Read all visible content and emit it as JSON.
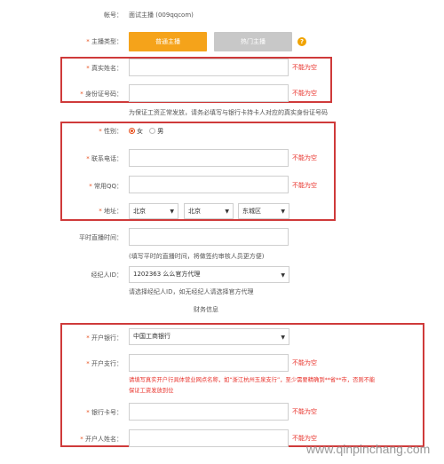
{
  "account": {
    "label": "帐号：",
    "value": "面试主播 (009qqcom)"
  },
  "anchor_type": {
    "label": "主播类型：",
    "normal_button": "普通主播",
    "hot_button": "热门主播",
    "help_glyph": "?"
  },
  "real_name": {
    "label": "真实姓名：",
    "error": "不能为空"
  },
  "id_number": {
    "label": "身份证号码：",
    "error": "不能为空"
  },
  "id_hint": "为保证工资正常发放，请务必填写与银行卡持卡人对应的真实身份证号码",
  "gender": {
    "label": "性别：",
    "female": "女",
    "male": "男"
  },
  "phone": {
    "label": "联系电话：",
    "error": "不能为空"
  },
  "qq": {
    "label": "常用QQ：",
    "error": "不能为空"
  },
  "address": {
    "label": "地址：",
    "province": "北京",
    "city": "北京",
    "district": "东城区"
  },
  "live_time": {
    "label": "平时直播时间：",
    "hint": "(填写平时的直播时间，将做签约审核人员更方便)"
  },
  "agent": {
    "label": "经纪人ID：",
    "value": "1202363 么么官方代理",
    "hint": "请选择经纪人ID，如无经纪人请选择官方代理"
  },
  "finance": {
    "title": "财务信息"
  },
  "bank": {
    "label": "开户银行：",
    "value": "中国工商银行"
  },
  "branch": {
    "label": "开户支行：",
    "error": "不能为空",
    "hint_line1": "请填写真实开户行具体营业网点名称，如“浙江杭州玉泉支行”，至少需要精确到**省**市，否则不能",
    "hint_line2": "保证工资发放到位"
  },
  "card_number": {
    "label": "银行卡号：",
    "error": "不能为空"
  },
  "holder_name": {
    "label": "开户人姓名：",
    "error": "不能为空"
  },
  "watermark": "www.qinpinchang.com",
  "colors": {
    "accent": "#f5a31a",
    "disabled_button": "#c8c8c8",
    "error": "#e8312a",
    "box": "#cf3a3a"
  }
}
